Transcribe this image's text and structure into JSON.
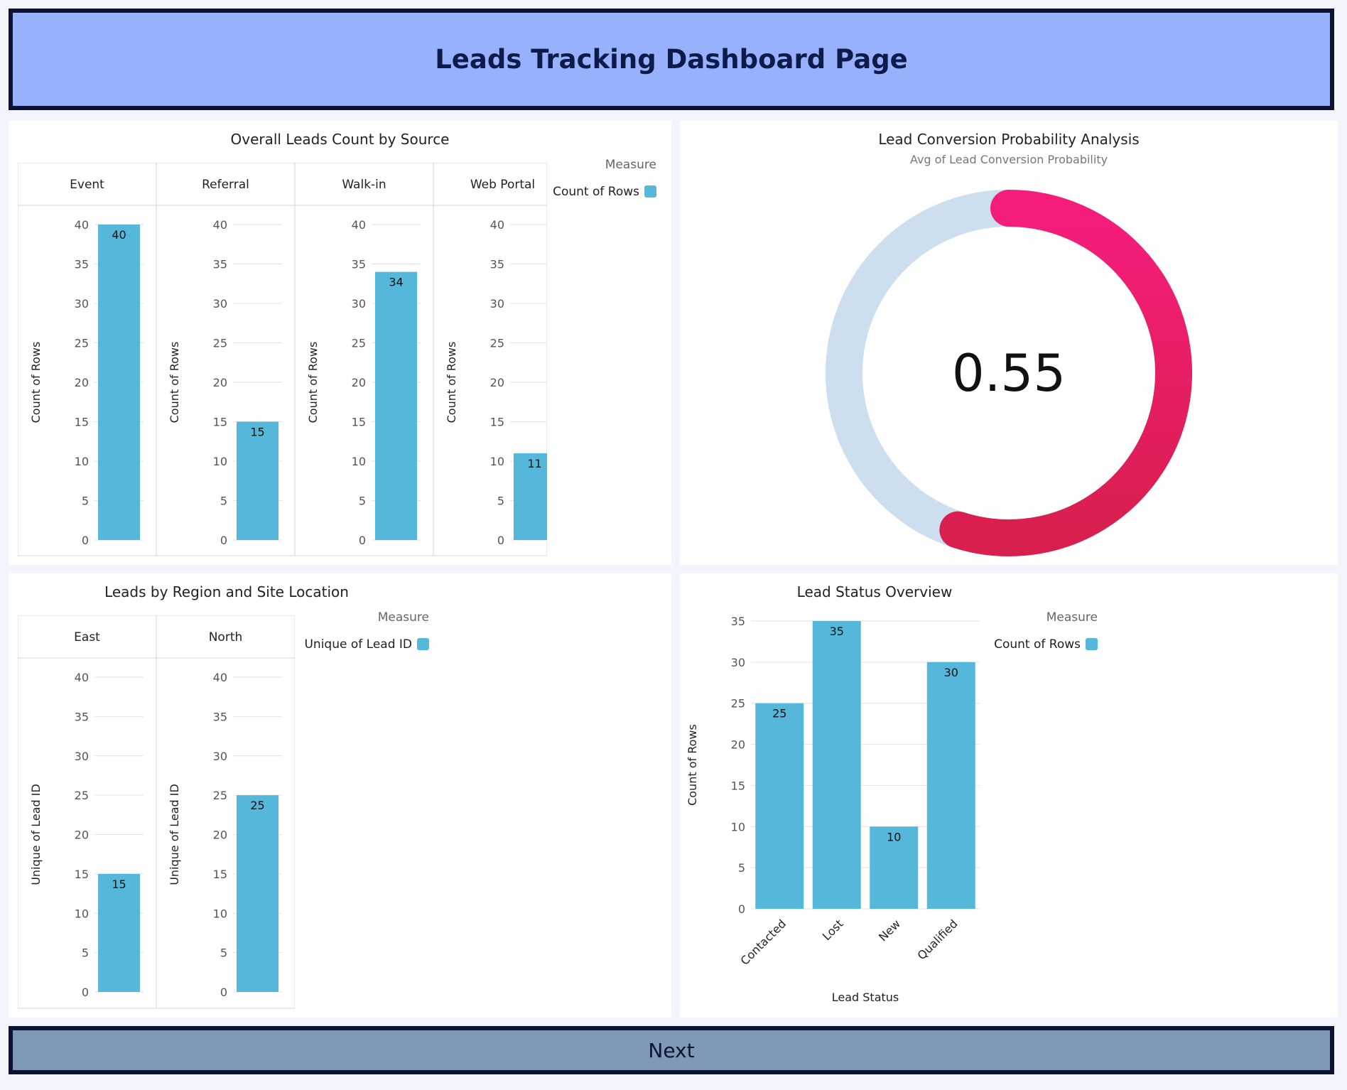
{
  "header": {
    "title": "Leads Tracking Dashboard Page"
  },
  "footer": {
    "next_label": "Next"
  },
  "panels": {
    "source": {
      "title": "Overall Leads Count by Source",
      "legend_title": "Measure",
      "legend_item": "Count of Rows",
      "axis_title": "Count of Rows"
    },
    "gauge": {
      "title": "Lead Conversion Probability Analysis",
      "subtitle": "Avg of Lead Conversion Probability",
      "value_text": "0.55"
    },
    "region": {
      "title": "Leads by Region and Site Location",
      "legend_title": "Measure",
      "legend_item": "Unique of Lead ID",
      "axis_title": "Unique of Lead ID"
    },
    "status": {
      "title": "Lead Status Overview",
      "legend_title": "Measure",
      "legend_item": "Count of Rows",
      "axis_title": "Count of Rows",
      "x_title": "Lead Status"
    }
  },
  "colors": {
    "bar": "#55b7da",
    "gauge_track": "#cddeee",
    "gauge_start": "#f51d7c",
    "gauge_end": "#d81f4d"
  },
  "chart_data": [
    {
      "type": "bar",
      "title": "Overall Leads Count by Source",
      "facets": [
        "Event",
        "Referral",
        "Walk-in",
        "Web Portal"
      ],
      "series": [
        {
          "name": "Count of Rows",
          "values": [
            40,
            15,
            34,
            11
          ]
        }
      ],
      "ylabel": "Count of Rows",
      "ylim": [
        0,
        40
      ],
      "yticks": [
        0,
        5,
        10,
        15,
        20,
        25,
        30,
        35,
        40
      ],
      "legend": "top-right",
      "grid": true
    },
    {
      "type": "gauge",
      "title": "Lead Conversion Probability Analysis",
      "subtitle": "Avg of Lead Conversion Probability",
      "value": 0.55,
      "range": [
        0,
        1
      ]
    },
    {
      "type": "bar",
      "title": "Leads by Region and Site Location",
      "facets": [
        "East",
        "North"
      ],
      "series": [
        {
          "name": "Unique of Lead ID",
          "values": [
            15,
            25
          ]
        }
      ],
      "ylabel": "Unique of Lead ID",
      "ylim": [
        0,
        40
      ],
      "yticks": [
        0,
        5,
        10,
        15,
        20,
        25,
        30,
        35,
        40
      ],
      "legend": "top-right",
      "grid": true
    },
    {
      "type": "bar",
      "title": "Lead Status Overview",
      "categories": [
        "Contacted",
        "Lost",
        "New",
        "Qualified"
      ],
      "series": [
        {
          "name": "Count of Rows",
          "values": [
            25,
            35,
            10,
            30
          ]
        }
      ],
      "xlabel": "Lead Status",
      "ylabel": "Count of Rows",
      "ylim": [
        0,
        35
      ],
      "yticks": [
        0,
        5,
        10,
        15,
        20,
        25,
        30,
        35
      ],
      "legend": "top-right",
      "grid": true
    }
  ]
}
